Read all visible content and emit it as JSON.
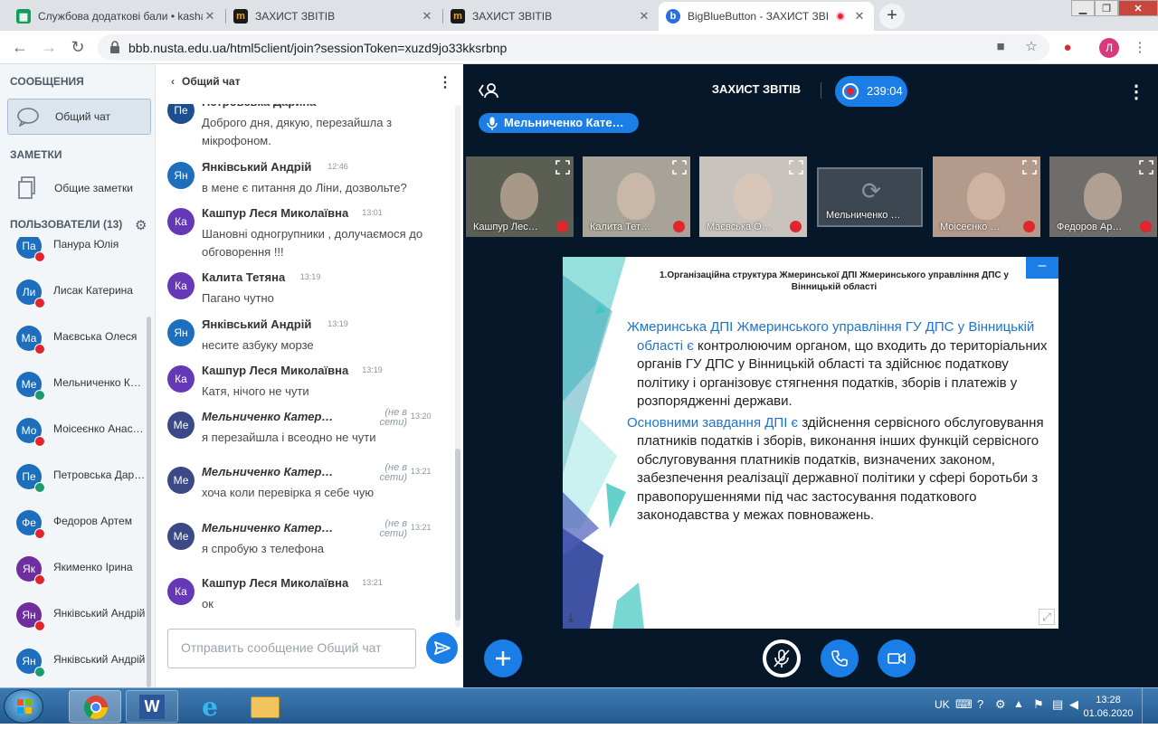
{
  "browser": {
    "tabs": [
      {
        "title": "Службова додаткові бали • kasha",
        "icon": "google-sheets-icon"
      },
      {
        "title": "ЗАХИСТ ЗВІТІВ",
        "icon": "moodle-icon"
      },
      {
        "title": "ЗАХИСТ ЗВІТІВ",
        "icon": "moodle-icon"
      },
      {
        "title": "BigBlueButton - ЗАХИСТ ЗВІТІ",
        "icon": "bigbluebutton-icon"
      }
    ],
    "url": "bbb.nusta.edu.ua/html5client/join?sessionToken=xuzd9jo33kksrbnp",
    "profile_initial": "Л"
  },
  "sidebar": {
    "messages_heading": "СООБЩЕНИЯ",
    "public_chat": "Общий чат",
    "notes_heading": "ЗАМЕТКИ",
    "shared_notes": "Общие заметки",
    "users_heading": "ПОЛЬЗОВАТЕЛИ (13)",
    "users": [
      {
        "initials": "Па",
        "name": "Панура Юлія",
        "color": "#1d6fbe",
        "mic": "muted"
      },
      {
        "initials": "Ли",
        "name": "Лисак Катерина",
        "color": "#1d6fbe",
        "mic": "muted"
      },
      {
        "initials": "Ма",
        "name": "Маєвська Олеся",
        "color": "#1d6fbe",
        "mic": "muted"
      },
      {
        "initials": "Ме",
        "name": "Мельниченко Катерина",
        "color": "#1d6fbe",
        "mic": "listen"
      },
      {
        "initials": "Мо",
        "name": "Моісеєнко Анастасія",
        "color": "#1d6fbe",
        "mic": "muted"
      },
      {
        "initials": "Пе",
        "name": "Петровська Дарина",
        "color": "#1d6fbe",
        "mic": "listen"
      },
      {
        "initials": "Фе",
        "name": "Федоров Артем",
        "color": "#1d6fbe",
        "mic": "muted"
      },
      {
        "initials": "Як",
        "name": "Якименко Ірина",
        "color": "#6f2ea0",
        "mic": "muted"
      },
      {
        "initials": "Ян",
        "name": "Янківський Андрій",
        "color": "#6f2ea0",
        "mic": "muted"
      },
      {
        "initials": "Ян",
        "name": "Янківський Андрій",
        "color": "#1d6fbe",
        "mic": "listen"
      }
    ]
  },
  "chat": {
    "header": "Общий чат",
    "messages": [
      {
        "initials": "Пе",
        "color": "#1d4e8f",
        "name": "Петровська Дарина",
        "time": "",
        "offline": false,
        "text": "Доброго дня, дякую, перезайшла з мікрофоном."
      },
      {
        "initials": "Ян",
        "color": "#1d6fbe",
        "name": "Янківський Андрій",
        "time": "12:46",
        "offline": false,
        "text": "в мене є питання до Ліни, дозвольте?"
      },
      {
        "initials": "Ка",
        "color": "#6538b8",
        "name": "Кашпур Леся Миколаївна",
        "time": "13:01",
        "offline": false,
        "text": "Шановні одногрупники , долучаємося до обговорення !!!"
      },
      {
        "initials": "Ка",
        "color": "#6538b8",
        "name": "Калита Тетяна",
        "time": "13:19",
        "offline": false,
        "text": "Пагано чутно"
      },
      {
        "initials": "Ян",
        "color": "#1d6fbe",
        "name": "Янківський Андрій",
        "time": "13:19",
        "offline": false,
        "text": "несите азбуку морзе"
      },
      {
        "initials": "Ка",
        "color": "#6538b8",
        "name": "Кашпур Леся Миколаївна",
        "time": "13:19",
        "offline": false,
        "text": "Катя, нічого не чути"
      },
      {
        "initials": "Ме",
        "color": "#3b4a86",
        "name": "Мельниченко Катер…",
        "time": "13:20",
        "offline": true,
        "text": "я перезайшла і всеодно не чути"
      },
      {
        "initials": "Ме",
        "color": "#3b4a86",
        "name": "Мельниченко Катер…",
        "time": "13:21",
        "offline": true,
        "text": "хоча коли перевірка я себе чую"
      },
      {
        "initials": "Ме",
        "color": "#3b4a86",
        "name": "Мельниченко Катер…",
        "time": "13:21",
        "offline": true,
        "text": "я спробую з телефона"
      },
      {
        "initials": "Ка",
        "color": "#6538b8",
        "name": "Кашпур Леся Миколаївна",
        "time": "13:21",
        "offline": false,
        "text": "ок"
      }
    ],
    "offline_label": "(не в сети)",
    "input_placeholder": "Отправить сообщение Общий чат"
  },
  "meeting": {
    "title": "ЗАХИСТ ЗВІТІВ",
    "recording_time": "239:04",
    "talking": "Мельниченко Кате…",
    "videos": [
      {
        "label": "Кашпур Лес…",
        "bg": "#5b5e52"
      },
      {
        "label": "Калита Тет…",
        "bg": "#a7a398"
      },
      {
        "label": "Маєвська О…",
        "bg": "#c8c3bd"
      },
      {
        "label": "Мельниченко …",
        "bg": "#3d4752",
        "blank": true
      },
      {
        "label": "Моісеєнко …",
        "bg": "#b49a8a"
      },
      {
        "label": "Федоров Ар…",
        "bg": "#6f6d6a"
      }
    ],
    "slide": {
      "title": "1.Організаційна структура Жмеринської ДПІ Жмеринського управління ДПС у Вінницькій області",
      "p1_highlight": "Жмеринська ДПІ Жмеринського управління ГУ ДПС у Вінницькій області є",
      "p1_rest": " контролюючим органом, що входить до територіальних органів ГУ ДПС у Вінницькій області та здійснює податкову політику і організовує стягнення податків, зборів і платежів у розпорядженні держави.",
      "p2_highlight": "Основними завдання ДПІ є",
      "p2_rest": " здійснення сервісного обслуговування платників податків і зборів, виконання інших функцій сервісного обслуговування платників податків, визначених законом, забезпечення реалізації державної політики у сфері боротьби з правопорушеннями під час застосування податкового законодавства у межах повноважень."
    }
  },
  "taskbar": {
    "lang": "UK",
    "time": "13:28",
    "date": "01.06.2020"
  },
  "colors": {
    "accent": "#1a7ee6",
    "main_bg": "#06172a",
    "muted": "#e0252c",
    "listen": "#1a9c6c"
  }
}
